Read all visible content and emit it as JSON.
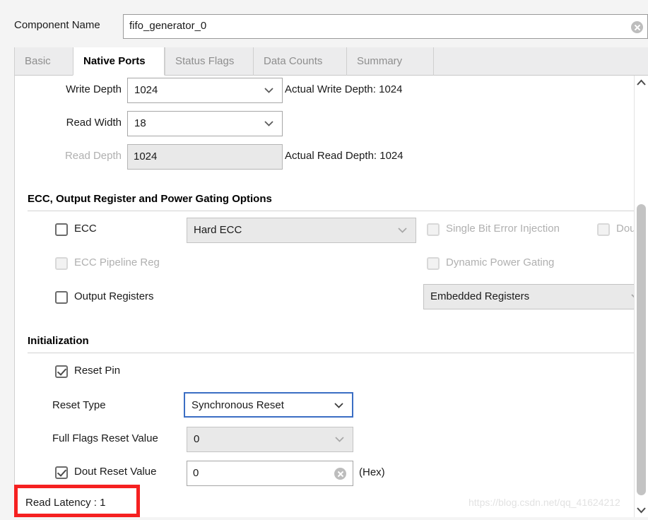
{
  "header": {
    "component_name_label": "Component Name",
    "component_name_value": "fifo_generator_0",
    "clear_icon": "clear-circle-icon"
  },
  "tabs": [
    {
      "label": "Basic",
      "active": false
    },
    {
      "label": "Native Ports",
      "active": true
    },
    {
      "label": "Status Flags",
      "active": false
    },
    {
      "label": "Data Counts",
      "active": false
    },
    {
      "label": "Summary",
      "active": false
    }
  ],
  "ports": {
    "write_depth_label": "Write Depth",
    "write_depth_value": "1024",
    "actual_write_depth": "Actual Write Depth: 1024",
    "read_width_label": "Read Width",
    "read_width_value": "18",
    "read_depth_label": "Read Depth",
    "read_depth_value": "1024",
    "actual_read_depth": "Actual Read Depth: 1024"
  },
  "ecc_section": {
    "title": "ECC, Output Register and Power Gating Options",
    "ecc_checkbox_label": "ECC",
    "ecc_mode_value": "Hard ECC",
    "single_bit_error_injection_label": "Single Bit Error Injection",
    "double_bit_error_injection_label": "Dou",
    "ecc_pipeline_reg_label": "ECC Pipeline Reg",
    "dynamic_power_gating_label": "Dynamic Power Gating",
    "output_registers_label": "Output Registers",
    "output_registers_value": "Embedded Registers"
  },
  "initialization_section": {
    "title": "Initialization",
    "reset_pin_label": "Reset Pin",
    "reset_type_label": "Reset Type",
    "reset_type_value": "Synchronous Reset",
    "full_flags_reset_value_label": "Full Flags Reset Value",
    "full_flags_reset_value": "0",
    "dout_reset_value_label": "Dout Reset Value",
    "dout_reset_value": "0",
    "hex_hint": "(Hex)"
  },
  "footer": {
    "read_latency": "Read Latency : 1",
    "annotation_color": "#f52020",
    "watermark": "https://blog.csdn.net/qq_41624212"
  },
  "colors": {
    "focus_border": "#3b6ec4",
    "panel_bg": "#ffffff",
    "chrome_bg": "#f4f4f4",
    "disabled_text": "#b0b0b0"
  }
}
